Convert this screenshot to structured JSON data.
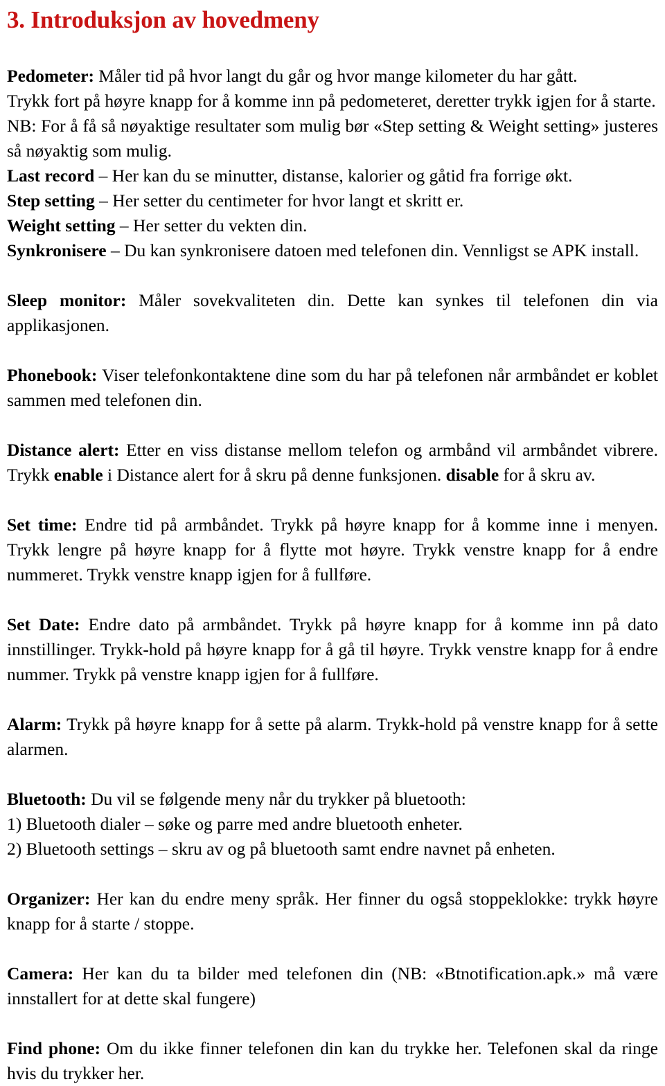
{
  "document": {
    "title": "3. Introduksjon av hovedmeny",
    "title_color": "#c81414",
    "language": "Norwegian"
  },
  "sections": {
    "pedometer": {
      "label": "Pedometer:",
      "line1_rest": " Måler tid på hvor langt du går og hvor mange kilometer du har gått.",
      "line2": "Trykk fort på høyre knapp for å komme inn på pedometeret, deretter trykk igjen for å starte.",
      "line3": "NB: For å få så nøyaktige resultater som mulig bør «Step setting & Weight setting» justeres så nøyaktig som mulig."
    },
    "last_record": {
      "label": "Last record",
      "rest": " – Her kan du se minutter, distanse, kalorier og gåtid fra forrige økt."
    },
    "step_setting": {
      "label": "Step setting",
      "rest": " – Her setter du centimeter for hvor langt et skritt er."
    },
    "weight_setting": {
      "label": "Weight setting",
      "rest": " – Her setter du vekten din."
    },
    "synkronisere": {
      "label": "Synkronisere",
      "rest": " – Du kan synkronisere datoen med telefonen din. Vennligst se APK install."
    },
    "sleep_monitor": {
      "label": "Sleep monitor:",
      "rest": " Måler sovekvaliteten din. Dette kan synkes til telefonen din via applikasjonen."
    },
    "phonebook": {
      "label": "Phonebook:",
      "rest": " Viser telefonkontaktene dine som du har på telefonen når armbåndet er koblet sammen med telefonen din."
    },
    "distance_alert": {
      "label": "Distance alert:",
      "rest": " Etter en viss distanse mellom telefon og armbånd vil armbåndet vibrere. Trykk ",
      "enable": "enable",
      "mid": " i Distance alert for å skru på denne funksjonen. ",
      "disable": "disable",
      "tail": " for å skru av."
    },
    "set_time": {
      "label": "Set time:",
      "rest": " Endre tid på armbåndet. Trykk på høyre knapp for å komme inne i menyen. Trykk lengre på høyre knapp for å flytte mot høyre. Trykk venstre knapp for å endre nummeret. Trykk venstre knapp igjen for å fullføre."
    },
    "set_date": {
      "label": "Set Date:",
      "rest": " Endre dato på armbåndet. Trykk på høyre knapp for å komme inn på dato innstillinger. Trykk-hold på høyre knapp for å gå til høyre. Trykk venstre knapp for å endre nummer. Trykk på venstre knapp igjen for å fullføre."
    },
    "alarm": {
      "label": "Alarm:",
      "rest": " Trykk på høyre knapp for å sette på alarm. Trykk-hold på venstre knapp for å sette alarmen."
    },
    "bluetooth": {
      "label": "Bluetooth:",
      "rest": " Du vil se følgende meny når du trykker på bluetooth:",
      "item1": "1) Bluetooth dialer – søke og parre med andre bluetooth enheter.",
      "item2": "2) Bluetooth settings – skru av og på bluetooth samt endre navnet på enheten."
    },
    "organizer": {
      "label": "Organizer:",
      "rest": " Her kan du endre meny språk. Her finner du også stoppeklokke: trykk høyre knapp for å starte / stoppe."
    },
    "camera": {
      "label": "Camera:",
      "rest": " Her kan du ta bilder med telefonen din (NB: «Btnotification.apk.» må være innstallert for at dette skal fungere)"
    },
    "find_phone": {
      "label": "Find phone:",
      "rest": " Om du ikke finner telefonen din kan du trykke her. Telefonen skal da ringe hvis du trykker her."
    }
  }
}
